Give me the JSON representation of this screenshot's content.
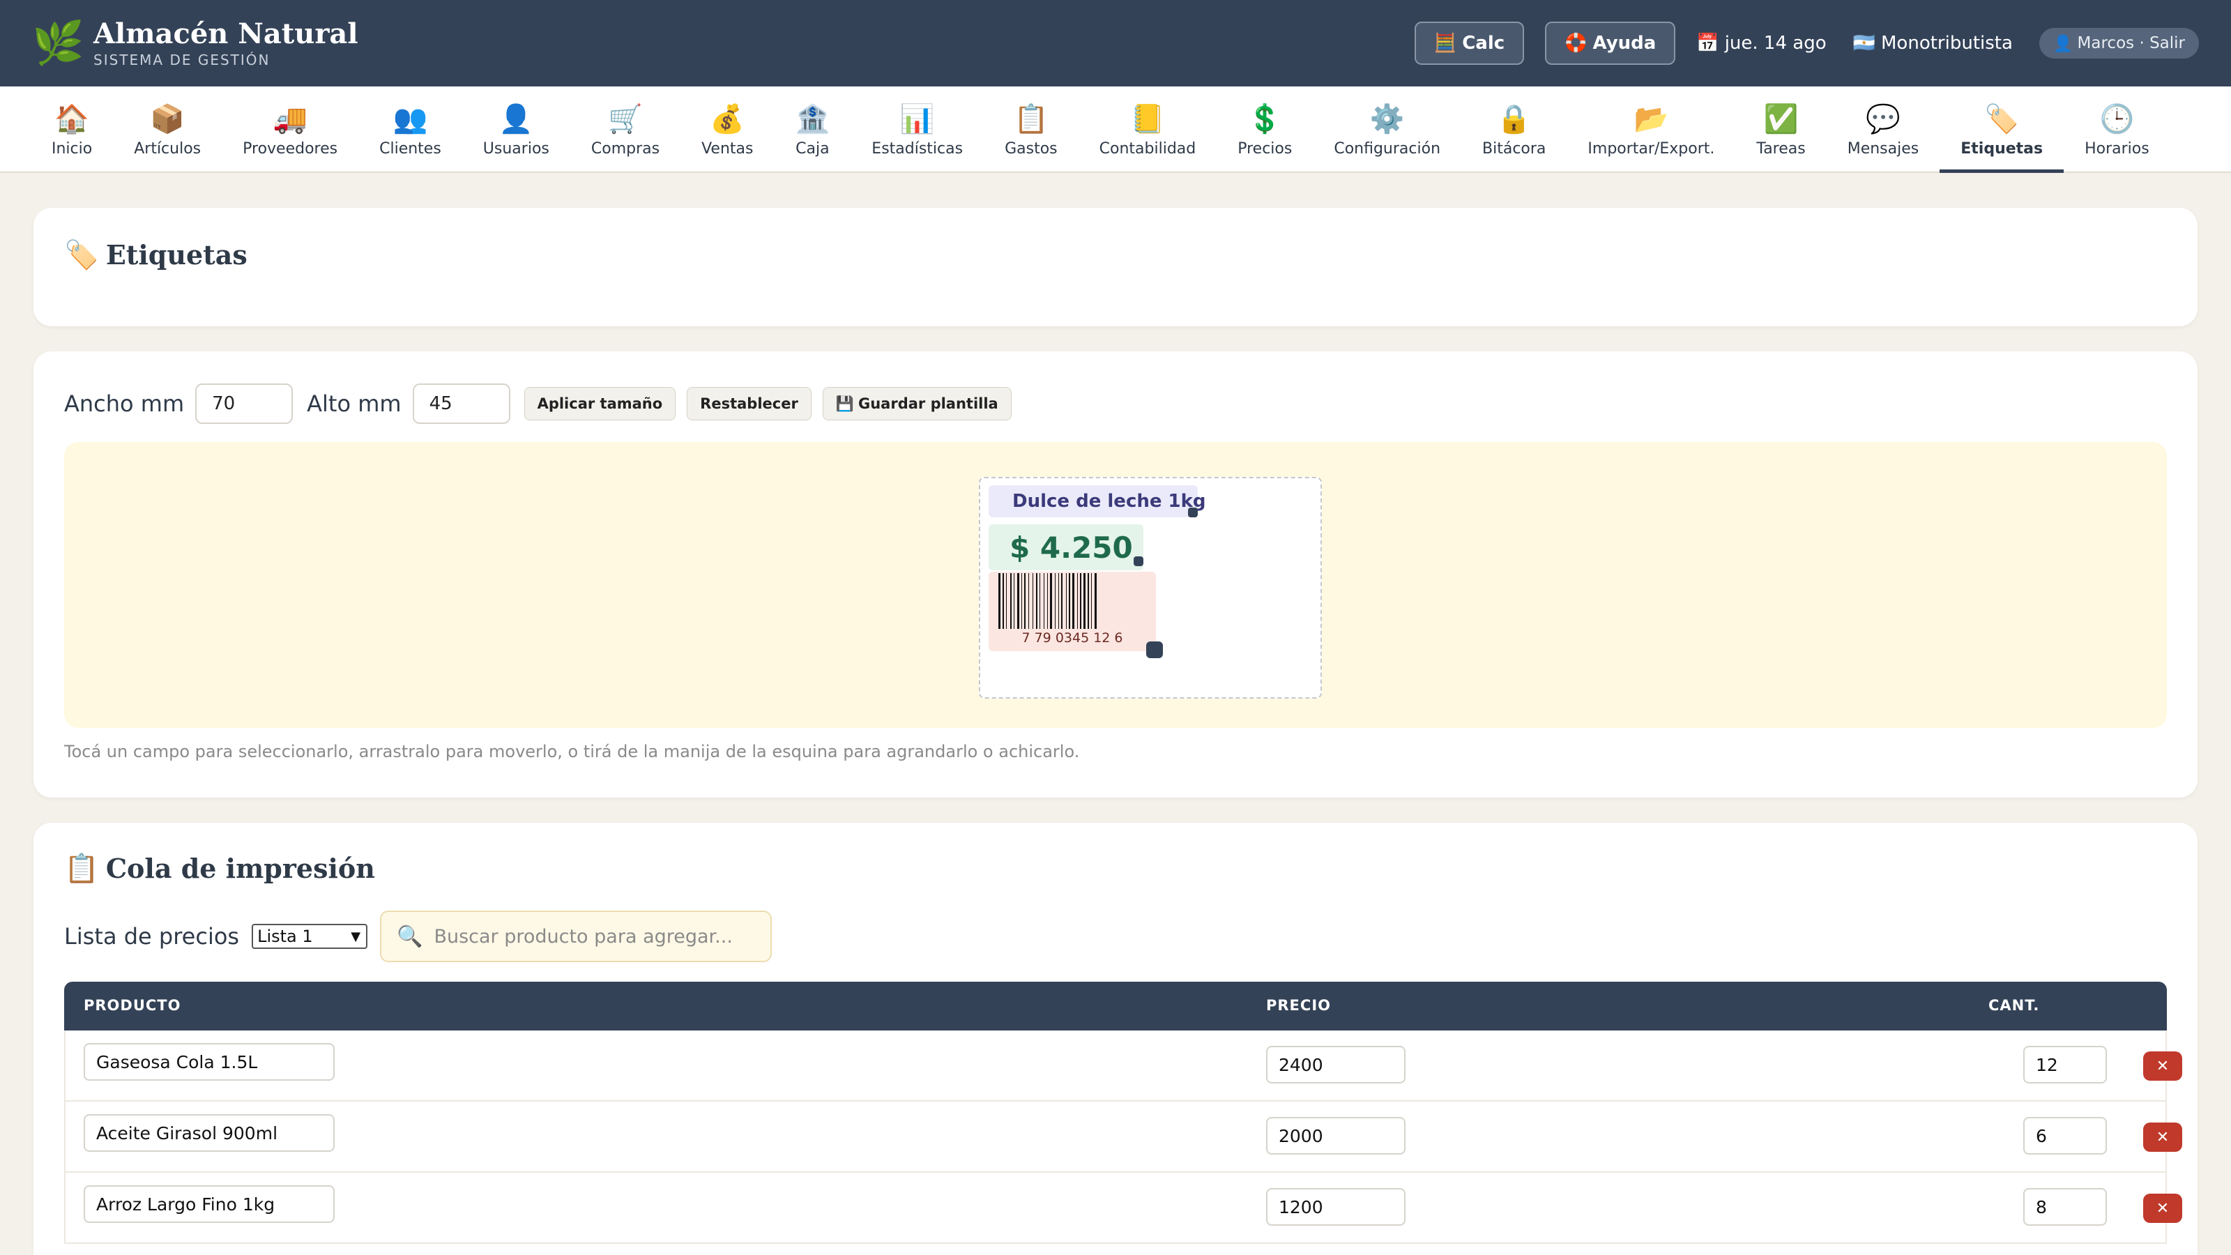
{
  "header": {
    "brand_icon": "🌿",
    "brand_title": "Almacén Natural",
    "brand_subtitle": "SISTEMA DE GESTIÓN",
    "calc_icon": "🧮",
    "calc_label": "Calc",
    "help_icon": "🛟",
    "help_label": "Ayuda",
    "date_icon": "📅",
    "date": "jue. 14 ago",
    "tax_icon": "🇦🇷",
    "tax_status": "Monotributista",
    "user_icon": "👤",
    "user_label": "Marcos · Salir"
  },
  "nav": {
    "items": [
      {
        "icon": "🏠",
        "label": "Inicio"
      },
      {
        "icon": "📦",
        "label": "Artículos"
      },
      {
        "icon": "🚚",
        "label": "Proveedores"
      },
      {
        "icon": "👥",
        "label": "Clientes"
      },
      {
        "icon": "👤",
        "label": "Usuarios"
      },
      {
        "icon": "🛒",
        "label": "Compras"
      },
      {
        "icon": "💰",
        "label": "Ventas"
      },
      {
        "icon": "🏦",
        "label": "Caja"
      },
      {
        "icon": "📊",
        "label": "Estadísticas"
      },
      {
        "icon": "📋",
        "label": "Gastos"
      },
      {
        "icon": "📒",
        "label": "Contabilidad"
      },
      {
        "icon": "💲",
        "label": "Precios"
      },
      {
        "icon": "⚙️",
        "label": "Configuración"
      },
      {
        "icon": "🔒",
        "label": "Bitácora"
      },
      {
        "icon": "📂",
        "label": "Importar/Export."
      },
      {
        "icon": "✅",
        "label": "Tareas"
      },
      {
        "icon": "💬",
        "label": "Mensajes"
      },
      {
        "icon": "🏷️",
        "label": "Etiquetas"
      },
      {
        "icon": "🕒",
        "label": "Horarios"
      }
    ],
    "active": "Etiquetas"
  },
  "page": {
    "title_icon": "🏷️",
    "title": "Etiquetas"
  },
  "editor": {
    "width_label": "Ancho mm",
    "width_value": "70",
    "height_label": "Alto mm",
    "height_value": "45",
    "apply_label": "Aplicar tamaño",
    "reset_label": "Restablecer",
    "save_icon": "💾",
    "save_label": "Guardar plantilla",
    "label_name": "Dulce de leche 1kg",
    "label_price": "$ 4.250",
    "barcode_number": "7 79 0345 12 6",
    "hint": "Tocá un campo para seleccionarlo, arrastralo para moverlo, o tirá de la manija de la esquina para agrandarlo o achicarlo."
  },
  "queue": {
    "title_icon": "📋",
    "title": "Cola de impresión",
    "price_list_label": "Lista de precios",
    "price_list_value": "Lista 1",
    "search_icon": "🔍",
    "search_placeholder": "Buscar producto para agregar...",
    "columns": {
      "product": "PRODUCTO",
      "price": "PRECIO",
      "qty": "CANT."
    },
    "delete_label": "✕",
    "rows": [
      {
        "product": "Gaseosa Cola 1.5L",
        "price": "2400",
        "qty": "12"
      },
      {
        "product": "Aceite Girasol 900ml",
        "price": "2000",
        "qty": "6"
      },
      {
        "product": "Arroz Largo Fino 1kg",
        "price": "1200",
        "qty": "8"
      }
    ]
  },
  "colors": {
    "header_bg": "#344257",
    "page_bg": "#f4f1ea",
    "canvas_bg": "#fef9e0",
    "delete_red": "#c0392b"
  }
}
